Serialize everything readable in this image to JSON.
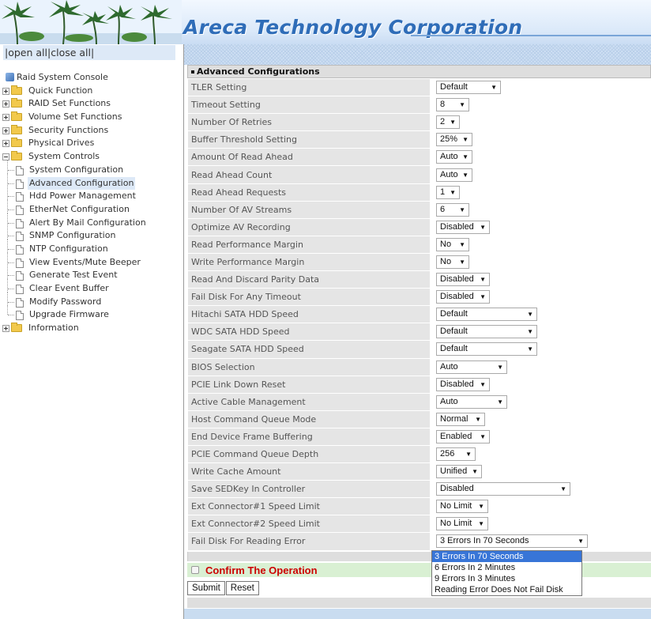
{
  "brand": "Areca Technology Corporation",
  "nav": {
    "open_all": "open all",
    "close_all": "close all",
    "separator": "|",
    "root": "Raid System Console",
    "items": [
      {
        "label": "Quick Function",
        "kind": "folder",
        "expanded": false
      },
      {
        "label": "RAID Set Functions",
        "kind": "folder",
        "expanded": false
      },
      {
        "label": "Volume Set Functions",
        "kind": "folder",
        "expanded": false
      },
      {
        "label": "Security Functions",
        "kind": "folder",
        "expanded": false
      },
      {
        "label": "Physical Drives",
        "kind": "folder",
        "expanded": false
      },
      {
        "label": "System Controls",
        "kind": "folder",
        "expanded": true
      },
      {
        "label": "System Configuration",
        "kind": "page"
      },
      {
        "label": "Advanced Configuration",
        "kind": "page",
        "selected": true
      },
      {
        "label": "Hdd Power Management",
        "kind": "page"
      },
      {
        "label": "EtherNet Configuration",
        "kind": "page"
      },
      {
        "label": "Alert By Mail Configuration",
        "kind": "page"
      },
      {
        "label": "SNMP Configuration",
        "kind": "page"
      },
      {
        "label": "NTP Configuration",
        "kind": "page"
      },
      {
        "label": "View Events/Mute Beeper",
        "kind": "page"
      },
      {
        "label": "Generate Test Event",
        "kind": "page"
      },
      {
        "label": "Clear Event Buffer",
        "kind": "page"
      },
      {
        "label": "Modify Password",
        "kind": "page"
      },
      {
        "label": "Upgrade Firmware",
        "kind": "page"
      },
      {
        "label": "Information",
        "kind": "folder",
        "expanded": false
      }
    ]
  },
  "panel": {
    "title": "Advanced Configurations",
    "settings": [
      {
        "label": "TLER Setting",
        "value": "Default"
      },
      {
        "label": "Timeout Setting",
        "value": "8"
      },
      {
        "label": "Number Of Retries",
        "value": "2"
      },
      {
        "label": "Buffer Threshold Setting",
        "value": "25%"
      },
      {
        "label": "Amount Of Read Ahead",
        "value": "Auto"
      },
      {
        "label": "Read Ahead Count",
        "value": "Auto"
      },
      {
        "label": "Read Ahead Requests",
        "value": "1"
      },
      {
        "label": "Number Of AV Streams",
        "value": "6"
      },
      {
        "label": "Optimize AV Recording",
        "value": "Disabled"
      },
      {
        "label": "Read Performance Margin",
        "value": "No"
      },
      {
        "label": "Write Performance Margin",
        "value": "No"
      },
      {
        "label": "Read And Discard Parity Data",
        "value": "Disabled"
      },
      {
        "label": "Fail Disk For Any Timeout",
        "value": "Disabled"
      },
      {
        "label": "Hitachi SATA HDD Speed",
        "value": "Default"
      },
      {
        "label": "WDC SATA HDD Speed",
        "value": "Default"
      },
      {
        "label": "Seagate SATA HDD Speed",
        "value": "Default"
      },
      {
        "label": "BIOS Selection",
        "value": "Auto"
      },
      {
        "label": "PCIE Link Down Reset",
        "value": "Disabled"
      },
      {
        "label": "Active Cable Management",
        "value": "Auto"
      },
      {
        "label": "Host Command Queue Mode",
        "value": "Normal"
      },
      {
        "label": "End Device Frame Buffering",
        "value": "Enabled"
      },
      {
        "label": "PCIE Command Queue Depth",
        "value": "256"
      },
      {
        "label": "Write Cache Amount",
        "value": "Unified"
      },
      {
        "label": "Save SEDKey In Controller",
        "value": "Disabled"
      },
      {
        "label": "Ext Connector#1 Speed Limit",
        "value": "No Limit"
      },
      {
        "label": "Ext Connector#2 Speed Limit",
        "value": "No Limit"
      },
      {
        "label": "Fail Disk For Reading Error",
        "value": "3 Errors In 70 Seconds"
      }
    ],
    "dropdown_options": [
      "3 Errors In 70 Seconds",
      "6 Errors In 2 Minutes",
      "9 Errors In 3 Minutes",
      "Reading Error Does Not Fail Disk"
    ],
    "dropdown_selected": "3 Errors In 70 Seconds",
    "confirm_label": "Confirm The Operation",
    "confirm_checked": false,
    "submit_label": "Submit",
    "reset_label": "Reset"
  },
  "colors": {
    "brand_blue": "#2f6db8",
    "confirm_red": "#cc0000",
    "confirm_bg": "#d9f0d3",
    "highlight": "#3875d7"
  }
}
